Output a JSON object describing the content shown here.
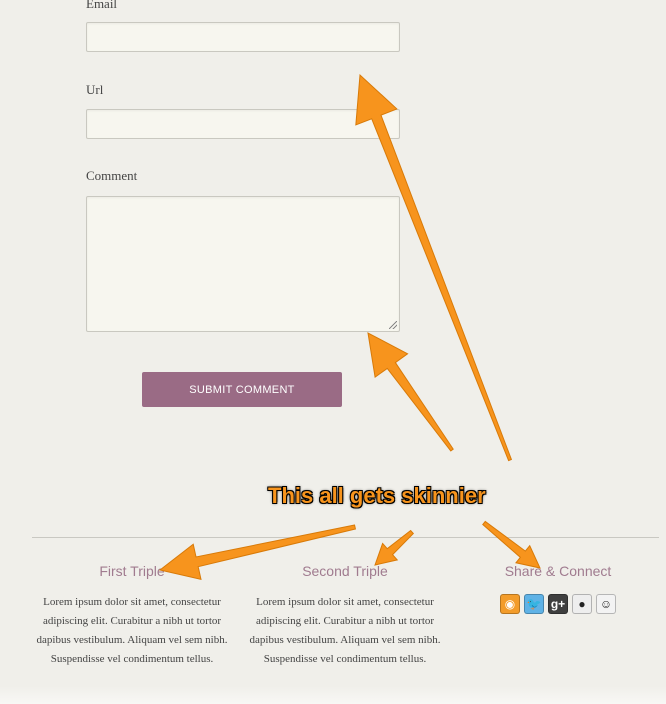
{
  "form": {
    "email_label": "Email",
    "email_value": "",
    "url_label": "Url",
    "url_value": "",
    "comment_label": "Comment",
    "comment_value": "",
    "submit_label": "SUBMIT COMMENT"
  },
  "footer": {
    "columns": [
      {
        "title": "First Triple",
        "text": "Lorem ipsum dolor sit amet, consectetur adipiscing elit. Curabitur a nibh ut tortor dapibus vestibulum. Aliquam vel sem nibh. Suspendisse vel condimentum tellus."
      },
      {
        "title": "Second Triple",
        "text": "Lorem ipsum dolor sit amet, consectetur adipiscing elit. Curabitur a nibh ut tortor dapibus vestibulum. Aliquam vel sem nibh. Suspendisse vel condimentum tellus."
      },
      {
        "title": "Share & Connect",
        "icons": [
          {
            "name": "rss-icon",
            "glyph": "◉",
            "color": "#f39c2a"
          },
          {
            "name": "twitter-icon",
            "glyph": "🐦",
            "color": "#5fb2e6"
          },
          {
            "name": "google-plus-icon",
            "glyph": "g+",
            "color": "#3f3f3f"
          },
          {
            "name": "github-icon",
            "glyph": "●",
            "color": "#eeeeee"
          },
          {
            "name": "reddit-icon",
            "glyph": "☺",
            "color": "#f3f3f3"
          }
        ]
      }
    ]
  },
  "annotation": {
    "text": "This all gets skinnier",
    "arrow_color": "#f7941d"
  }
}
